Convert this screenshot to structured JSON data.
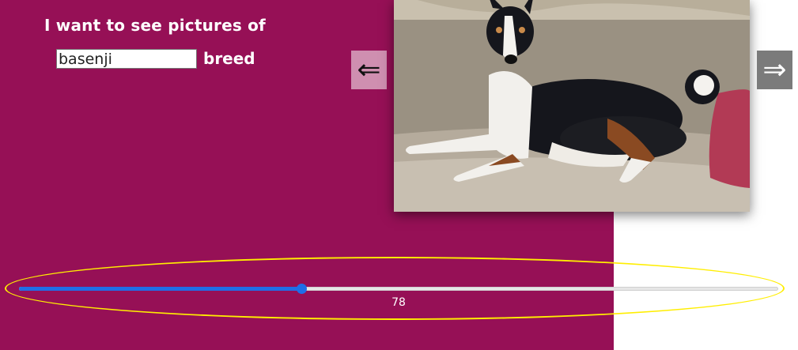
{
  "colors": {
    "panel_bg": "#961056",
    "page_bg": "#ffffff",
    "slider_accent": "#1f6ee8",
    "highlight": "#ffee00"
  },
  "header": {
    "prompt_text": "I want to see pictures of",
    "breed_suffix": "breed"
  },
  "search": {
    "value": "basenji"
  },
  "nav": {
    "prev_label": "⇐",
    "next_label": "⇒",
    "prev_icon": "left-double-arrow-icon",
    "next_icon": "right-double-arrow-icon"
  },
  "photo": {
    "subject": "basenji-dog-on-couch"
  },
  "slider": {
    "value": "78",
    "fraction": 0.372
  }
}
